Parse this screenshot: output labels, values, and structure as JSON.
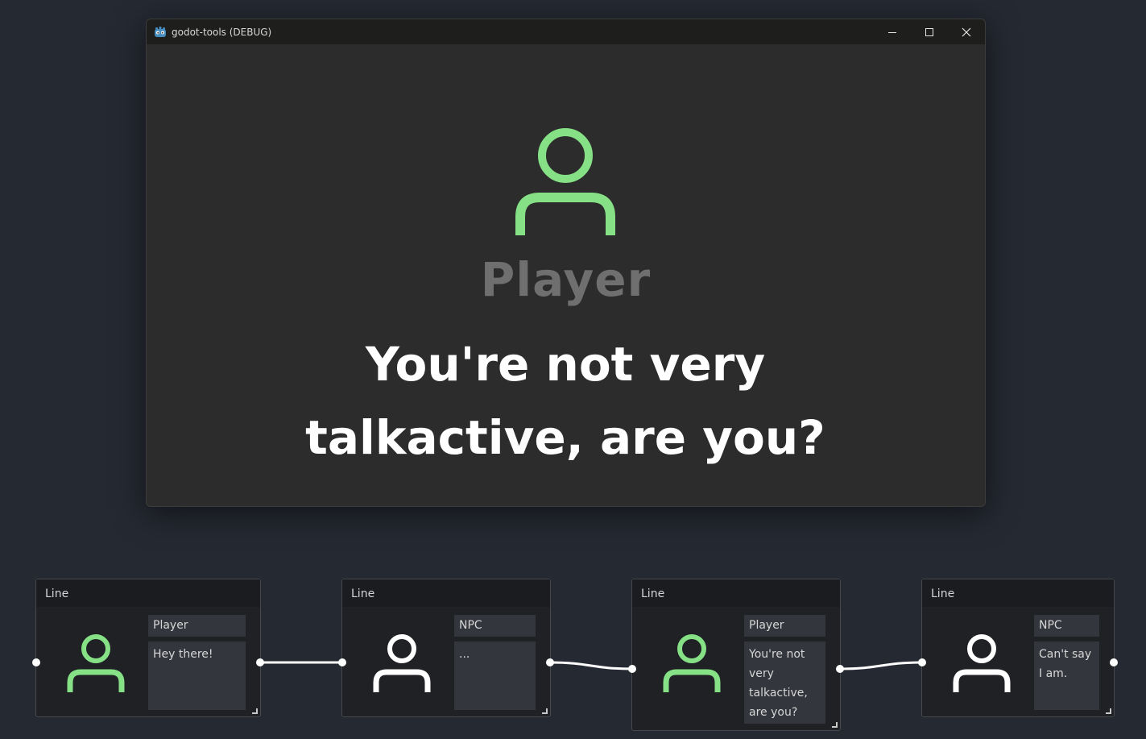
{
  "window": {
    "title": "godot-tools (DEBUG)",
    "controls": {
      "minimize_icon": "minimize-icon",
      "maximize_icon": "maximize-icon",
      "close_icon": "close-icon"
    }
  },
  "dialogue_view": {
    "speaker": "Player",
    "line_1": "You're not very",
    "line_2": "talkactive, are you?",
    "player_color": "#86e186"
  },
  "graph": {
    "nodes": [
      {
        "title": "Line",
        "speaker": "Player",
        "text": "Hey there!",
        "avatar_color": "#86e186"
      },
      {
        "title": "Line",
        "speaker": "NPC",
        "text": "...",
        "avatar_color": "#ffffff"
      },
      {
        "title": "Line",
        "speaker": "Player",
        "text": "You're not very talkactive, are you?",
        "avatar_color": "#86e186"
      },
      {
        "title": "Line",
        "speaker": "NPC",
        "text": "Can't say I am.",
        "avatar_color": "#ffffff"
      }
    ]
  }
}
